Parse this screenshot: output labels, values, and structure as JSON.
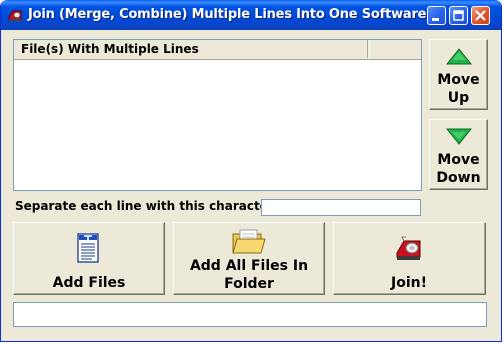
{
  "window": {
    "title": "Join (Merge, Combine) Multiple Lines Into One Software",
    "app_icon": "red-tape-dispenser-icon",
    "controls": [
      "minimize",
      "maximize",
      "close"
    ]
  },
  "file_list": {
    "columns": [
      "File(s) With Multiple Lines",
      ""
    ],
    "rows": []
  },
  "side_buttons": {
    "move_up": {
      "line1": "Move",
      "line2": "Up",
      "icon": "green-up-triangle-icon"
    },
    "move_down": {
      "line1": "Move",
      "line2": "Down",
      "icon": "green-down-triangle-icon"
    }
  },
  "separator": {
    "label": "Separate each line with this character(s):",
    "value": ""
  },
  "buttons": {
    "add_files": {
      "label": "Add Files",
      "icon": "text-document-icon"
    },
    "add_folder": {
      "line1": "Add All Files In",
      "line2": "Folder",
      "icon": "open-folder-icon"
    },
    "join": {
      "label": "Join!",
      "icon": "tape-dispenser-icon"
    }
  },
  "status": {
    "text": ""
  },
  "colors": {
    "titlebar": "#0054e3",
    "accent_green": "#22b14c",
    "window_bg": "#ece9d8"
  }
}
